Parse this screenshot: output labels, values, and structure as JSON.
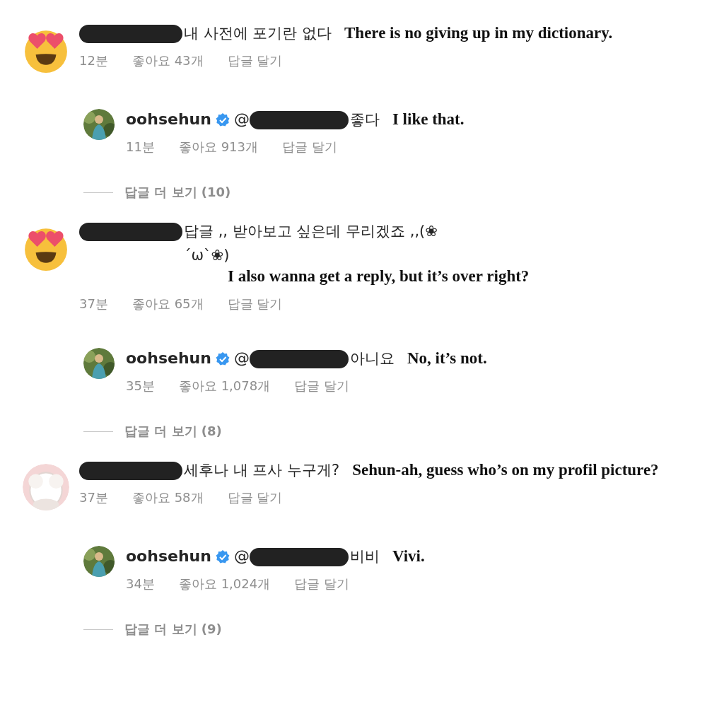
{
  "threads": [
    {
      "comment": {
        "avatar": {
          "kind": "emoji"
        },
        "text": "내 사전에 포기란 없다",
        "translation": "There is no giving up in my dictionary.",
        "time": "12분",
        "likes": "좋아요 43개",
        "reply_label": "답글 달기"
      },
      "reply": {
        "username": "oohsehun",
        "verified": true,
        "mention": "@",
        "text": "좋다",
        "translation": "I like that.",
        "time": "11분",
        "likes": "좋아요 913개",
        "reply_label": "답글 달기"
      },
      "more_replies": "답글 더 보기 (10)"
    },
    {
      "comment": {
        "avatar": {
          "kind": "emoji"
        },
        "text": "답글 ,, 받아보고 싶은데 무리겠죠 ,,(❀ ´ω`❀)",
        "translation": "I also wanna get a reply, but it’s over right?",
        "time": "37분",
        "likes": "좋아요 65개",
        "reply_label": "답글 달기"
      },
      "reply": {
        "username": "oohsehun",
        "verified": true,
        "mention": "@",
        "text": "아니요",
        "translation": "No, it’s not.",
        "time": "35분",
        "likes": "좋아요 1,078개",
        "reply_label": "답글 달기"
      },
      "more_replies": "답글 더 보기 (8)"
    },
    {
      "comment": {
        "text": "세후나 내 프사 누구게?",
        "translation": "Sehun-ah, guess who’s on my profil picture?",
        "time": "37분",
        "likes": "좋아요 58개",
        "reply_label": "답글 달기"
      },
      "reply": {
        "username": "oohsehun",
        "verified": true,
        "mention": "@",
        "text": "비비",
        "translation": "Vivi.",
        "time": "34분",
        "likes": "좋아요 1,024개",
        "reply_label": "답글 달기"
      },
      "more_replies": "답글 더 보기 (9)"
    }
  ]
}
